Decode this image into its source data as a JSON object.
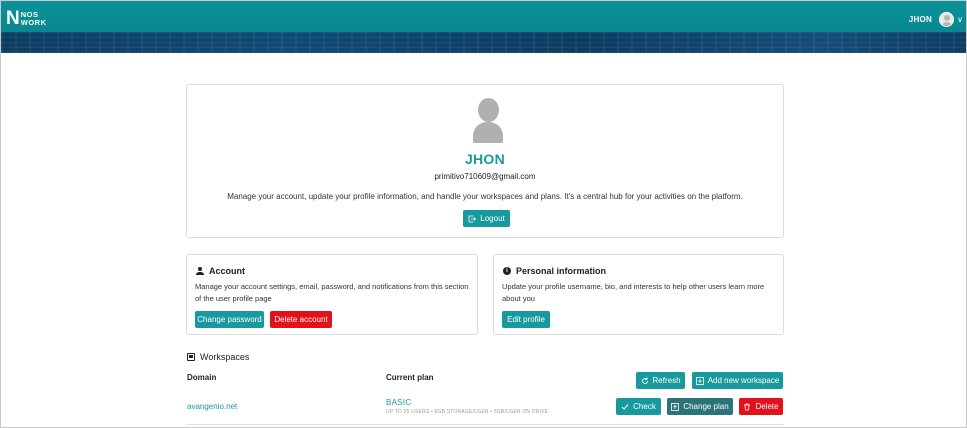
{
  "header": {
    "logo_letter": "N",
    "logo_line1": "NOS",
    "logo_line2": "WORK",
    "username": "JHON",
    "menu_chevron": "∨"
  },
  "profile": {
    "name": "JHON",
    "email": "primitivo710609@gmail.com",
    "description": "Manage your account, update your profile information, and handle your workspaces and plans. It's a central hub for your activities on the platform.",
    "logout_label": "Logout"
  },
  "account": {
    "title": "Account",
    "text": "Manage your account settings, email, password, and notifications from this section of the user profile page",
    "change_password_label": "Change password",
    "delete_account_label": "Delete account"
  },
  "personal_info": {
    "title": "Personal information",
    "text": "Update your profile username, bio, and interests to help other users learn more about you",
    "edit_profile_label": "Edit profile"
  },
  "workspaces": {
    "title": "Workspaces",
    "col_domain": "Domain",
    "col_plan": "Current plan",
    "refresh_label": "Refresh",
    "add_label": "Add new workspace",
    "rows": [
      {
        "domain": "avangenio.net",
        "plan": "BASIC",
        "plan_desc": "UP TO 25 USERS • 6GB STORAGE/USER • 5GB/USER ON DRIVE",
        "check_label": "Check",
        "change_plan_label": "Change plan",
        "delete_label": "Delete"
      }
    ]
  },
  "colors": {
    "primary": "#17999d",
    "danger": "#e4101a",
    "dark_teal": "#2b7279"
  }
}
